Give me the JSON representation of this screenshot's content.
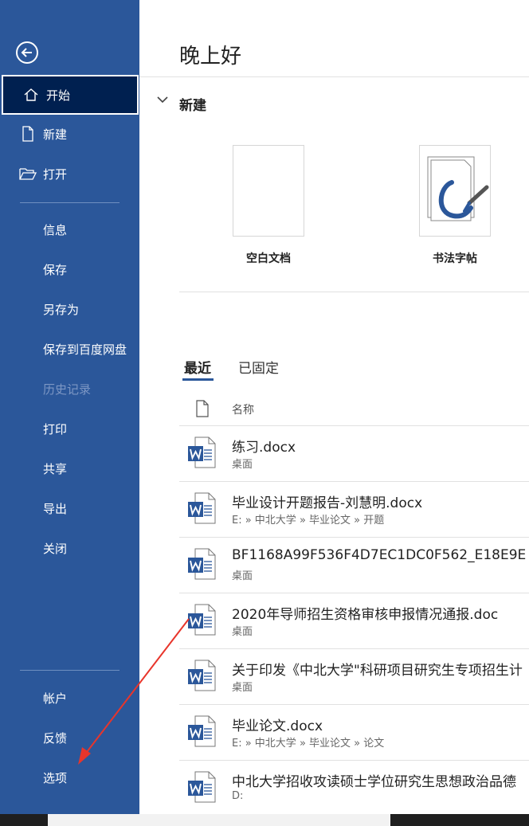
{
  "sidebar": {
    "items": [
      {
        "label": "开始",
        "icon": "home-icon"
      },
      {
        "label": "新建",
        "icon": "new-document-icon"
      },
      {
        "label": "打开",
        "icon": "open-folder-icon"
      },
      {
        "label": "信息"
      },
      {
        "label": "保存"
      },
      {
        "label": "另存为"
      },
      {
        "label": "保存到百度网盘"
      },
      {
        "label": "历史记录"
      },
      {
        "label": "打印"
      },
      {
        "label": "共享"
      },
      {
        "label": "导出"
      },
      {
        "label": "关闭"
      }
    ],
    "bottom_items": [
      {
        "label": "帐户"
      },
      {
        "label": "反馈"
      },
      {
        "label": "选项"
      }
    ],
    "colors": {
      "background": "#2b579a",
      "active": "#002050"
    }
  },
  "main": {
    "greeting": "晚上好",
    "new_section": {
      "title": "新建",
      "templates": [
        {
          "name": "空白文档"
        },
        {
          "name": "书法字帖"
        }
      ]
    },
    "tabs": [
      {
        "label": "最近"
      },
      {
        "label": "已固定"
      }
    ],
    "column_header": "名称",
    "files": [
      {
        "name": "练习.docx",
        "path": "桌面"
      },
      {
        "name": "毕业设计开题报告-刘慧明.docx",
        "path": "E: » 中北大学 » 毕业论文 » 开题"
      },
      {
        "name": "BF1168A99F536F4D7EC1DC0F562_E18E9E",
        "path": "桌面"
      },
      {
        "name": "2020年导师招生资格审核申报情况通报.doc",
        "path": "桌面"
      },
      {
        "name": "关于印发《中北大学\"科研项目研究生专项招生计",
        "path": "桌面"
      },
      {
        "name": "毕业论文.docx",
        "path": "E: » 中北大学 » 毕业论文 » 论文"
      },
      {
        "name": "中北大学招收攻读硕士学位研究生思想政治品德",
        "path": "D:"
      }
    ]
  }
}
